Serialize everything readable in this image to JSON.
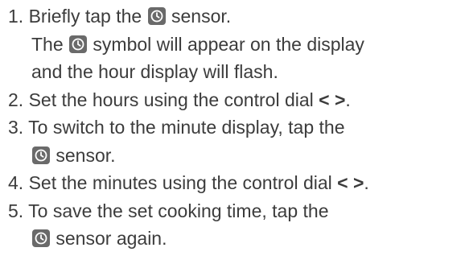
{
  "steps": [
    {
      "number": "1.",
      "line1_before_icon": " Briefly tap the ",
      "line1_after_icon": " sensor.",
      "line2_before_icon": "The ",
      "line2_after_icon": " symbol will appear on the display",
      "line3": "and the hour display will flash."
    },
    {
      "number": "2.",
      "text": " Set the hours using the control dial ",
      "dial": "< >",
      "end": "."
    },
    {
      "number": "3.",
      "line1": " To switch to the minute display, tap the",
      "line2_after_icon": " sensor."
    },
    {
      "number": "4.",
      "text": " Set the minutes using the control dial ",
      "dial": "< >",
      "end": "."
    },
    {
      "number": "5.",
      "line1": " To save the set cooking time, tap the",
      "line2_after_icon": " sensor again."
    }
  ],
  "icon": "clock-icon",
  "colors": {
    "text": "#3c3c3c",
    "icon_bg": "#6a6a6a",
    "icon_fg": "#ffffff"
  }
}
